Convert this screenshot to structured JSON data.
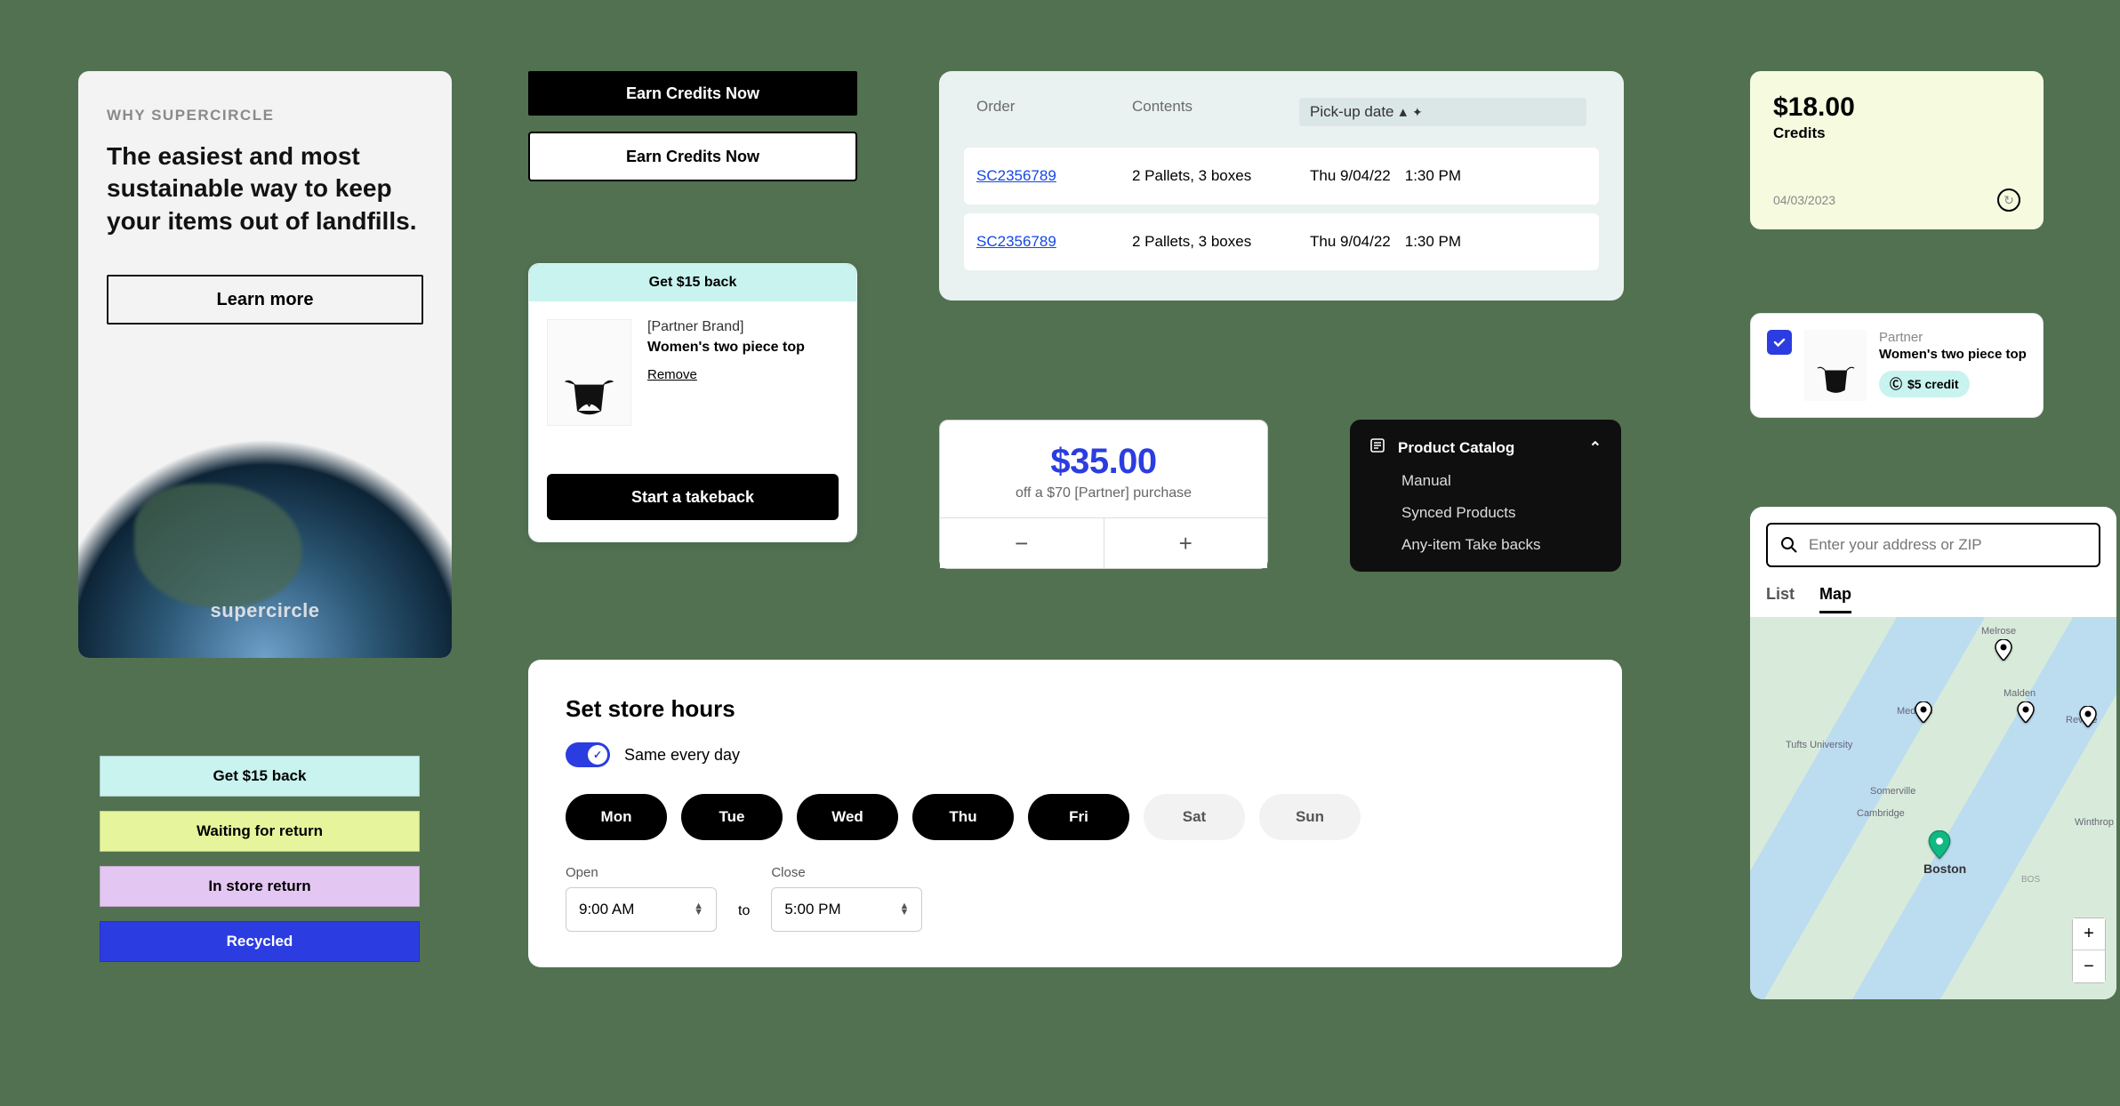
{
  "hero": {
    "eyebrow": "WHY SUPERCIRCLE",
    "headline": "The easiest and most sustainable way to keep your items out of landfills.",
    "cta": "Learn more",
    "logo": "supercircle"
  },
  "earn": {
    "primary": "Earn Credits Now",
    "secondary": "Earn Credits Now"
  },
  "takeback": {
    "badge": "Get $15 back",
    "brand": "[Partner Brand]",
    "product": "Women's two piece top",
    "remove": "Remove",
    "cta": "Start a takeback"
  },
  "orders": {
    "cols": {
      "order": "Order",
      "contents": "Contents",
      "date": "Pick-up date"
    },
    "rows": [
      {
        "id": "SC2356789",
        "contents": "2 Pallets, 3 boxes",
        "date": "Thu 9/04/22",
        "time": "1:30 PM"
      },
      {
        "id": "SC2356789",
        "contents": "2 Pallets, 3 boxes",
        "date": "Thu 9/04/22",
        "time": "1:30 PM"
      }
    ]
  },
  "discount": {
    "amount": "$35.00",
    "sub": "off a $70 [Partner] purchase"
  },
  "catalog": {
    "title": "Product Catalog",
    "items": [
      "Manual",
      "Synced Products",
      "Any-item Take backs"
    ]
  },
  "credits": {
    "amount": "$18.00",
    "label": "Credits",
    "date": "04/03/2023"
  },
  "product": {
    "brand": "Partner",
    "name": "Women's two piece top",
    "credit": "$5 credit"
  },
  "statuses": [
    "Get $15 back",
    "Waiting for return",
    "In store return",
    "Recycled"
  ],
  "hours": {
    "title": "Set store hours",
    "same": "Same every day",
    "days": [
      "Mon",
      "Tue",
      "Wed",
      "Thu",
      "Fri",
      "Sat",
      "Sun"
    ],
    "active": [
      true,
      true,
      true,
      true,
      true,
      false,
      false
    ],
    "open_lbl": "Open",
    "close_lbl": "Close",
    "to": "to",
    "open": "9:00 AM",
    "close": "5:00 PM"
  },
  "map": {
    "placeholder": "Enter your address or ZIP",
    "tabs": [
      "List",
      "Map"
    ],
    "labels": [
      "Melrose",
      "Malden",
      "Medford",
      "Revere",
      "Tufts University",
      "Somerville",
      "Cambridge",
      "Boston",
      "Winthrop",
      "BOS"
    ]
  }
}
